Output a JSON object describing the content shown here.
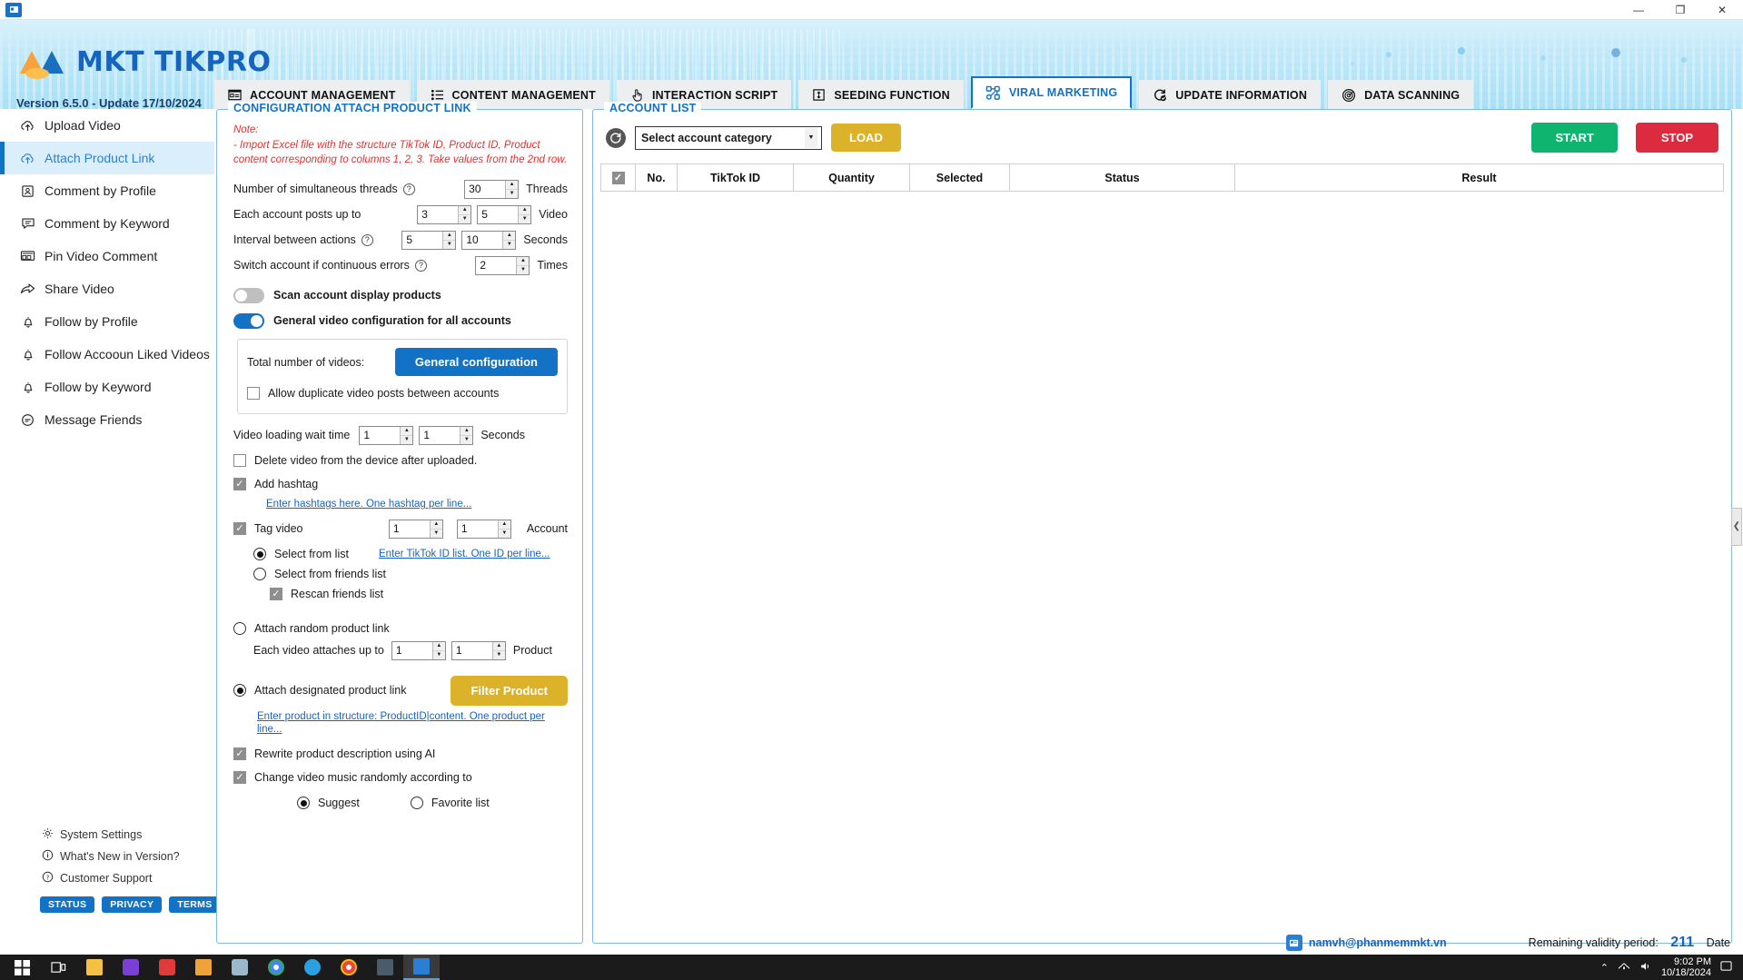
{
  "window": {
    "minimize": "—",
    "maximize": "❐",
    "close": "✕",
    "app_icon": "app-icon"
  },
  "header": {
    "brand": "MKT TIKPRO",
    "version_line": "Version  6.5.0  - Update  17/10/2024"
  },
  "tabs": [
    {
      "label": "ACCOUNT MANAGEMENT",
      "icon": "id-card-icon",
      "active": false
    },
    {
      "label": "CONTENT MANAGEMENT",
      "icon": "list-icon",
      "active": false
    },
    {
      "label": "INTERACTION SCRIPT",
      "icon": "hand-pointer-icon",
      "active": false
    },
    {
      "label": "SEEDING FUNCTION",
      "icon": "arrows-vertical-icon",
      "active": false
    },
    {
      "label": "VIRAL MARKETING",
      "icon": "network-nodes-icon",
      "active": true
    },
    {
      "label": "UPDATE INFORMATION",
      "icon": "refresh-check-icon",
      "active": false
    },
    {
      "label": "DATA SCANNING",
      "icon": "radar-icon",
      "active": false
    }
  ],
  "sidebar": {
    "items": [
      {
        "label": "Upload Video",
        "icon": "upload-cloud-icon",
        "active": false
      },
      {
        "label": "Attach Product Link",
        "icon": "upload-cloud-icon",
        "active": true
      },
      {
        "label": "Comment by Profile",
        "icon": "profile-card-icon",
        "active": false
      },
      {
        "label": "Comment by Keyword",
        "icon": "comment-icon",
        "active": false
      },
      {
        "label": "Pin Video Comment",
        "icon": "pin-comment-icon",
        "active": false
      },
      {
        "label": "Share Video",
        "icon": "share-arrow-icon",
        "active": false
      },
      {
        "label": "Follow by Profile",
        "icon": "bell-icon",
        "active": false
      },
      {
        "label": "Follow Accooun Liked Videos",
        "icon": "bell-icon",
        "active": false
      },
      {
        "label": "Follow by Keyword",
        "icon": "bell-icon",
        "active": false
      },
      {
        "label": "Message Friends",
        "icon": "message-icon",
        "active": false
      }
    ],
    "links": [
      {
        "label": "System Settings",
        "icon": "gear-icon"
      },
      {
        "label": "What's New in Version?",
        "icon": "info-icon"
      },
      {
        "label": "Customer Support",
        "icon": "question-icon"
      }
    ],
    "pills": [
      "STATUS",
      "PRIVACY",
      "TERMS"
    ]
  },
  "config": {
    "legend": "CONFIGURATION ATTACH PRODUCT LINK",
    "note_title": "Note:",
    "note_body": "- Import Excel file with the structure TikTok ID, Product ID, Product content corresponding to columns 1, 2, 3. Take values from the 2nd row.",
    "threads": {
      "label": "Number of simultaneous threads",
      "value": "30",
      "unit": "Threads",
      "help": "?"
    },
    "posts": {
      "label": "Each account posts up to",
      "min": "3",
      "max": "5",
      "unit": "Video"
    },
    "interval": {
      "label": "Interval between actions",
      "min": "5",
      "max": "10",
      "unit": "Seconds",
      "help": "?"
    },
    "switch_errors": {
      "label": "Switch account if continuous errors",
      "value": "2",
      "unit": "Times",
      "help": "?"
    },
    "toggle_scan": {
      "label": "Scan account display products",
      "on": false
    },
    "toggle_general": {
      "label": "General video configuration for all accounts",
      "on": true
    },
    "total_videos_label": "Total number of videos:",
    "general_config_button": "General configuration",
    "allow_duplicate": {
      "label": "Allow duplicate video posts between accounts",
      "checked": false
    },
    "wait_time": {
      "label": "Video loading wait time",
      "min": "1",
      "max": "1",
      "unit": "Seconds"
    },
    "delete_video": {
      "label": "Delete video from the device after uploaded.",
      "checked": false
    },
    "add_hashtag": {
      "label": "Add hashtag",
      "checked": true
    },
    "hashtag_link": "Enter hashtags here. One hashtag per line...",
    "tag_video": {
      "label": "Tag video",
      "min": "1",
      "max": "1",
      "unit": "Account",
      "checked": true
    },
    "select_from_list": {
      "label": "Select from list",
      "selected": true
    },
    "tiktok_id_link": "Enter TikTok ID list. One ID per line...",
    "select_from_friends": {
      "label": "Select from friends list",
      "selected": false
    },
    "rescan_friends": {
      "label": "Rescan friends list",
      "checked": true
    },
    "attach_random": {
      "label": "Attach random product link",
      "selected": false
    },
    "each_video_attaches": {
      "label": "Each video attaches up to",
      "min": "1",
      "max": "1",
      "unit": "Product"
    },
    "attach_designated": {
      "label": "Attach designated product link",
      "selected": true
    },
    "filter_product_button": "Filter Product",
    "product_structure_link": "Enter product in structure: ProductID|content. One product per line...",
    "rewrite_ai": {
      "label": "Rewrite product description using AI",
      "checked": true
    },
    "change_music": {
      "label": "Change video music randomly according to",
      "checked": true
    },
    "music_suggest": {
      "label": "Suggest",
      "selected": true
    },
    "music_favorite": {
      "label": "Favorite list",
      "selected": false
    }
  },
  "account_list": {
    "legend": "ACCOUNT LIST",
    "refresh_icon": "refresh-icon",
    "category_select": "Select account category",
    "load_button": "LOAD",
    "start_button": "START",
    "stop_button": "STOP",
    "columns": [
      "",
      "No.",
      "TikTok ID",
      "Quantity",
      "Selected",
      "Status",
      "Result"
    ],
    "rows": []
  },
  "footer": {
    "account": "namvh@phanmemmkt.vn",
    "validity_label": "Remaining validity period:",
    "validity_value": "211",
    "validity_unit": "Date"
  },
  "taskbar": {
    "time": "9:02 PM",
    "date": "10/18/2024",
    "start_icon": "windows-start-icon",
    "items": [
      "task-view-icon",
      "file-explorer-icon",
      "notepad-icon",
      "store-icon",
      "folder-icon",
      "photos-icon",
      "chrome-icon",
      "telegram-icon",
      "chrome-2-icon",
      "mail-icon",
      "app-icon"
    ]
  },
  "colors": {
    "accent": "#1273c6",
    "gold": "#dbb229",
    "green": "#0fb56e",
    "red": "#dc2b3e",
    "note_red": "#e03131"
  }
}
